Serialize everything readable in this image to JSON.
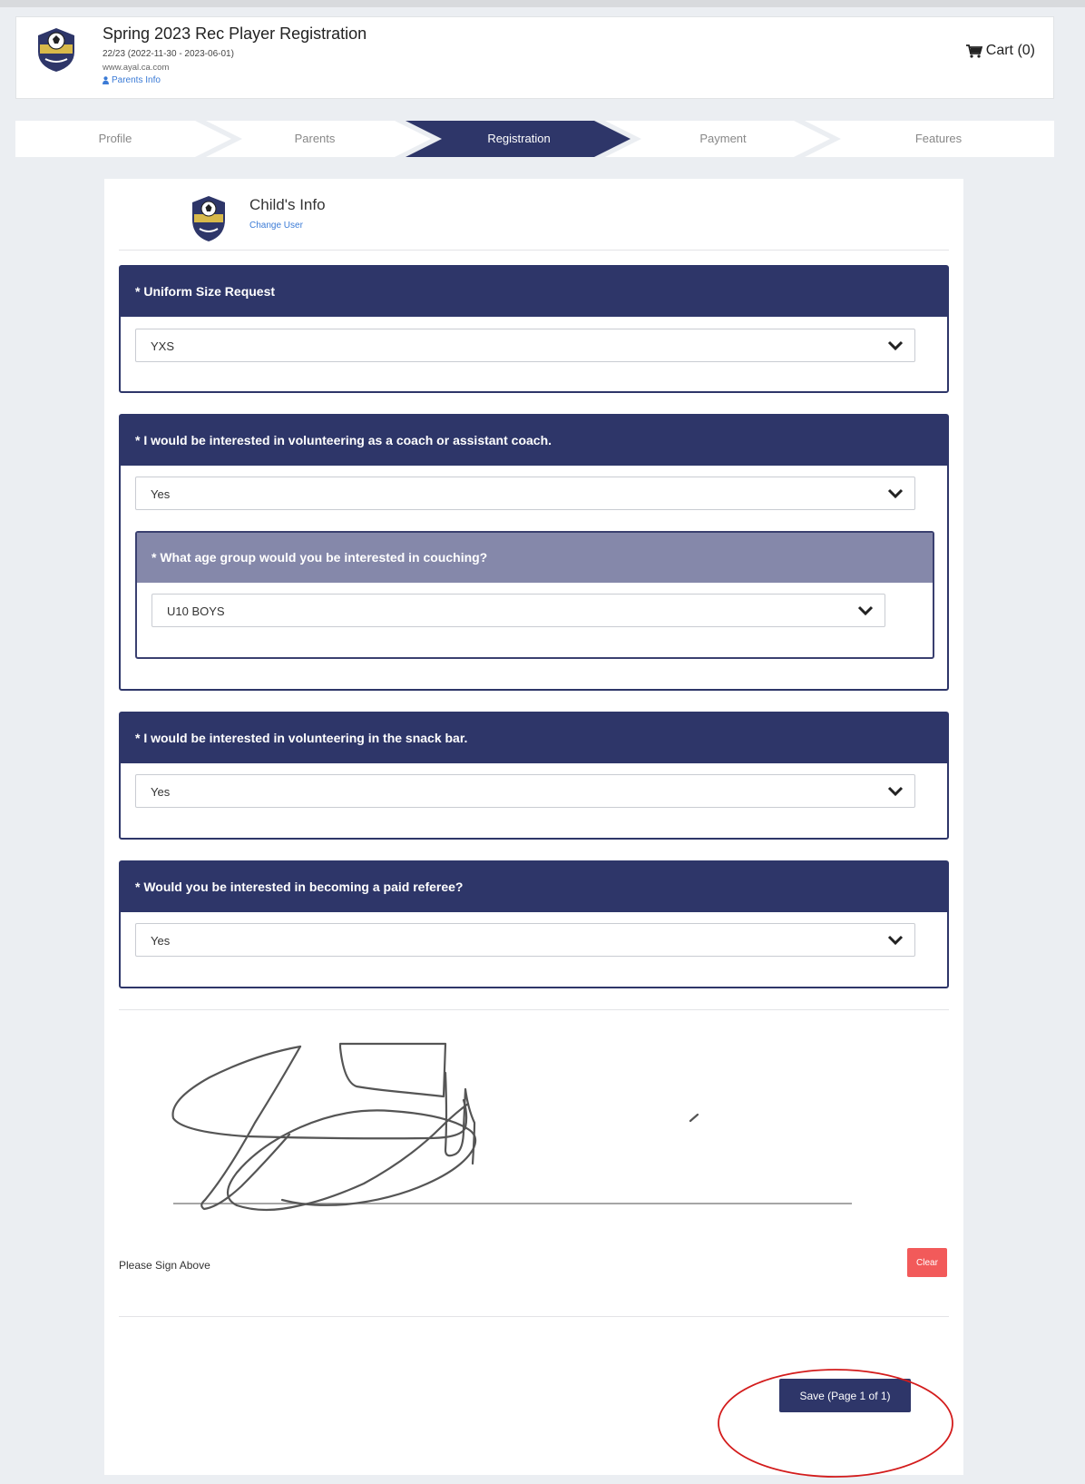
{
  "header": {
    "title": "Spring 2023 Rec Player Registration",
    "dates": "22/23 (2022-11-30 - 2023-06-01)",
    "site": "www.ayal.ca.com",
    "parents_link": "Parents Info",
    "cart": "Cart (0)"
  },
  "steps": [
    {
      "label": "Profile",
      "active": false
    },
    {
      "label": "Parents",
      "active": false
    },
    {
      "label": "Registration",
      "active": true
    },
    {
      "label": "Payment",
      "active": false
    },
    {
      "label": "Features",
      "active": false
    }
  ],
  "child": {
    "title": "Child's Info",
    "change_user": "Change User"
  },
  "questions": {
    "uniform": {
      "label": "* Uniform Size Request",
      "value": "YXS"
    },
    "coach": {
      "label": "* I would be interested in volunteering as a coach or assistant coach.",
      "value": "Yes"
    },
    "age_group": {
      "label": "* What age group would you be interested in couching?",
      "value": "U10 BOYS"
    },
    "snack": {
      "label": "* I would be interested in volunteering in the snack bar.",
      "value": "Yes"
    },
    "referee": {
      "label": "* Would you be interested in becoming a paid referee?",
      "value": "Yes"
    }
  },
  "signature": {
    "label": "Please Sign Above",
    "clear": "Clear"
  },
  "save": "Save (Page 1 of 1)",
  "colors": {
    "primary": "#2e3669",
    "sub_header": "#8588aa",
    "clear": "#f25a5a",
    "link": "#3b7bd6",
    "highlight": "#d31c1c"
  }
}
